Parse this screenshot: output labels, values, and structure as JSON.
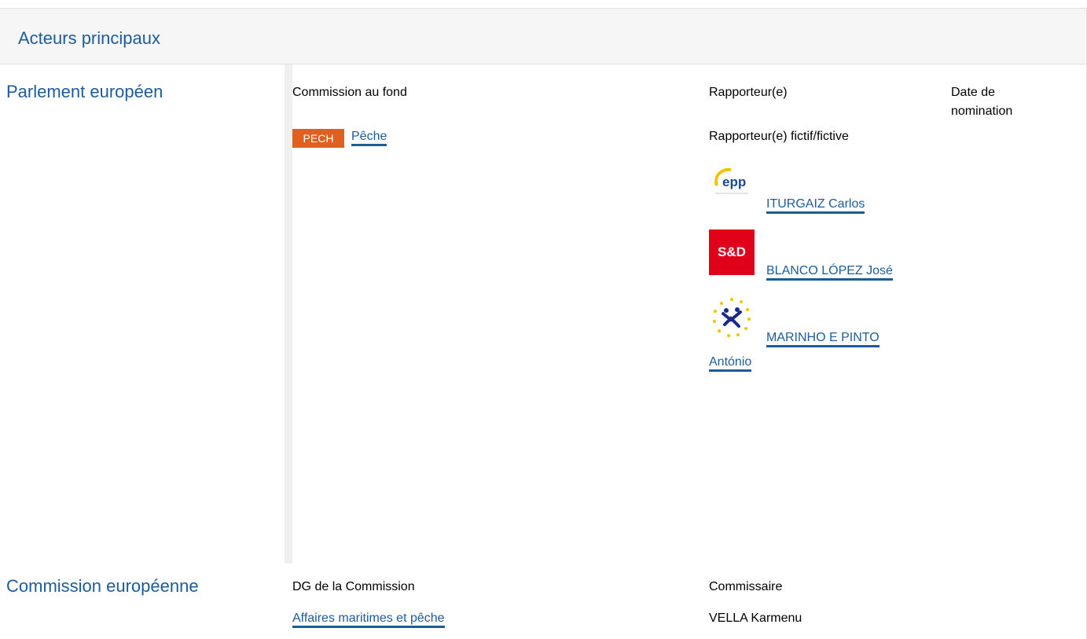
{
  "header": {
    "title": "Acteurs principaux"
  },
  "parliament": {
    "label": "Parlement européen",
    "committee_header": "Commission au fond",
    "rapporteur_header": "Rapporteur(e)",
    "date_header": "Date de nomination",
    "committee": {
      "badge": "PECH",
      "name": "Pêche",
      "badge_color": "#e06020"
    },
    "shadow_header": "Rapporteur(e) fictif/fictive",
    "shadow_rapporteurs": [
      {
        "name": "ITURGAIZ Carlos",
        "group_logo": "epp-logo",
        "logo_text": "epp"
      },
      {
        "name": "BLANCO LÓPEZ José",
        "group_logo": "s-and-d-logo",
        "logo_text": "S&D",
        "logo_color": "#e0001a"
      },
      {
        "name_line1": "MARINHO E PINTO",
        "name_line2": "António",
        "group_logo": "alde-logo"
      }
    ]
  },
  "commission": {
    "label": "Commission européenne",
    "dg_header": "DG de la Commission",
    "commissioner_header": "Commissaire",
    "dg_name": "Affaires maritimes et pêche",
    "commissioner_name": "VELLA Karmenu"
  },
  "colors": {
    "link": "#1d5c9a",
    "header_bg": "#f6f6f6"
  }
}
